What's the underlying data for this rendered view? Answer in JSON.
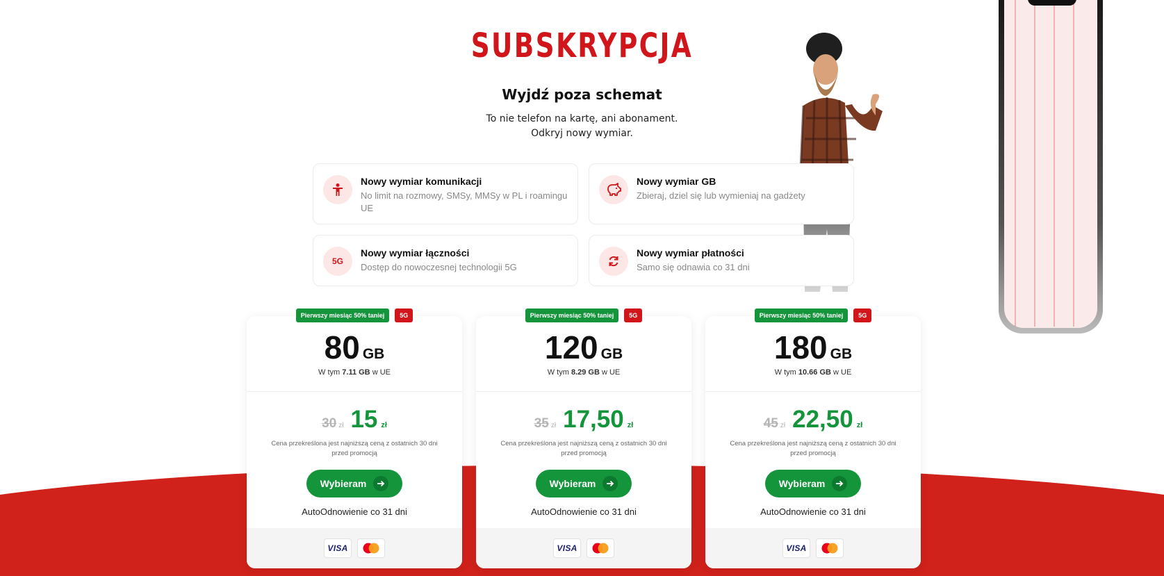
{
  "header": {
    "brand": "SUBSKRYPCJA",
    "subtitle": "Wyjdź poza schemat",
    "lead_line1": "To nie telefon na kartę, ani abonament.",
    "lead_line2": "Odkryj nowy wymiar."
  },
  "features": [
    {
      "icon": "person-icon",
      "title": "Nowy wymiar komunikacji",
      "description": "No limit na rozmowy, SMSy, MMSy w PL i roamingu UE"
    },
    {
      "icon": "piggy-bank-icon",
      "title": "Nowy wymiar GB",
      "description": "Zbieraj, dziel się lub wymieniaj na gadżety"
    },
    {
      "icon": "5g-icon",
      "icon_label": "5G",
      "title": "Nowy wymiar łączności",
      "description": "Dostęp do nowoczesnej technologii 5G"
    },
    {
      "icon": "refresh-icon",
      "title": "Nowy wymiar płatności",
      "description": "Samo się odnawia co 31 dni"
    }
  ],
  "plans": [
    {
      "promo_badge": "Pierwszy miesiąc 50% taniej",
      "network_badge": "5G",
      "gb": "80",
      "gb_unit": "GB",
      "eu_prefix": "W tym",
      "eu_gb": "7.11 GB",
      "eu_suffix": "w UE",
      "old_price": "30",
      "old_currency": "zł",
      "new_price": "15",
      "new_currency": "zł",
      "price_note": "Cena przekreślona jest najniższą ceną z ostatnich 30 dni przed promocją",
      "button_label": "Wybieram",
      "renewal": "AutoOdnowienie co 31 dni",
      "payment_visa": "VISA"
    },
    {
      "promo_badge": "Pierwszy miesiąc 50% taniej",
      "network_badge": "5G",
      "gb": "120",
      "gb_unit": "GB",
      "eu_prefix": "W tym",
      "eu_gb": "8.29 GB",
      "eu_suffix": "w UE",
      "old_price": "35",
      "old_currency": "zł",
      "new_price": "17,50",
      "new_currency": "zł",
      "price_note": "Cena przekreślona jest najniższą ceną z ostatnich 30 dni przed promocją",
      "button_label": "Wybieram",
      "renewal": "AutoOdnowienie co 31 dni",
      "payment_visa": "VISA"
    },
    {
      "promo_badge": "Pierwszy miesiąc 50% taniej",
      "network_badge": "5G",
      "gb": "180",
      "gb_unit": "GB",
      "eu_prefix": "W tym",
      "eu_gb": "10.66 GB",
      "eu_suffix": "w UE",
      "old_price": "45",
      "old_currency": "zł",
      "new_price": "22,50",
      "new_currency": "zł",
      "price_note": "Cena przekreślona jest najniższą ceną z ostatnich 30 dni przed promocją",
      "button_label": "Wybieram",
      "renewal": "AutoOdnowienie co 31 dni",
      "payment_visa": "VISA"
    }
  ],
  "colors": {
    "brand_red": "#d0161b",
    "green": "#14943b",
    "icon_bg": "#fde6e6"
  }
}
